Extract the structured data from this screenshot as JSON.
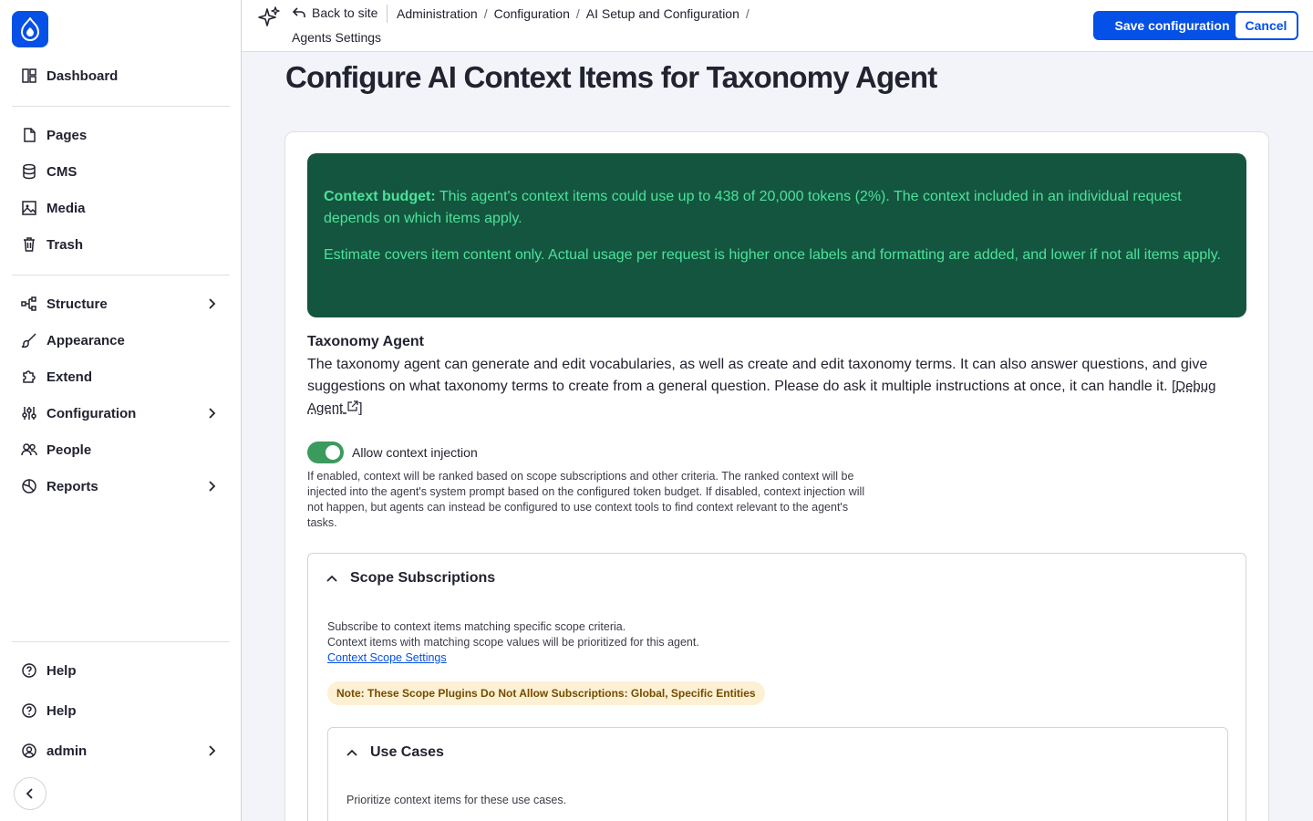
{
  "sidebar": {
    "items": [
      {
        "label": "Dashboard",
        "icon": "dashboard-icon"
      },
      {
        "label": "Pages",
        "icon": "page-icon"
      },
      {
        "label": "CMS",
        "icon": "database-icon"
      },
      {
        "label": "Media",
        "icon": "image-icon"
      },
      {
        "label": "Trash",
        "icon": "trash-icon"
      },
      {
        "label": "Structure",
        "icon": "structure-icon"
      },
      {
        "label": "Appearance",
        "icon": "brush-icon"
      },
      {
        "label": "Extend",
        "icon": "puzzle-icon"
      },
      {
        "label": "Configuration",
        "icon": "sliders-icon"
      },
      {
        "label": "People",
        "icon": "people-icon"
      },
      {
        "label": "Reports",
        "icon": "chart-pie-icon"
      }
    ],
    "bottom": [
      {
        "label": "Help",
        "icon": "help-icon"
      },
      {
        "label": "Help",
        "icon": "help-icon"
      },
      {
        "label": "admin",
        "icon": "user-icon"
      }
    ]
  },
  "topbar": {
    "back_label": "Back to site",
    "breadcrumbs": [
      "Administration",
      "Configuration",
      "AI Setup and Configuration"
    ],
    "breadcrumb_last": "Agents Settings",
    "save_label": "Save configuration",
    "cancel_label": "Cancel"
  },
  "page": {
    "title": "Configure AI Context Items for Taxonomy Agent",
    "budget_strong": "Context budget:",
    "budget_text": " This agent's context items could use up to 438 of 20,000 tokens (2%). The context included in an individual request depends on which items apply.",
    "budget_note": "Estimate covers item content only. Actual usage per request is higher once labels and formatting are added, and lower if not all items apply.",
    "agent_name": "Taxonomy Agent",
    "agent_desc": "The taxonomy agent can generate and edit vocabularies, as well as create and edit taxonomy terms. It can also answer questions, and give suggestions on what taxonomy terms to create from a general question. Please do ask it multiple instructions at once, it can handle it. ",
    "debug_link": "Debug Agent",
    "toggle_label": "Allow context injection",
    "toggle_on": true,
    "toggle_help": "If enabled, context will be ranked based on scope subscriptions and other criteria. The ranked context will be injected into the agent's system prompt based on the configured token budget. If disabled, context injection will not happen, but agents can instead be configured to use context tools to find context relevant to the agent's tasks.",
    "scope_title": "Scope Subscriptions",
    "scope_desc_1": "Subscribe to context items matching specific scope criteria.",
    "scope_desc_2": "Context items with matching scope values will be prioritized for this agent.",
    "scope_link": "Context Scope Settings",
    "note": "Note: These Scope Plugins Do Not Allow Subscriptions: Global, Specific Entities",
    "use_cases_title": "Use Cases",
    "use_cases_desc": "Prioritize context items for these use cases."
  },
  "colors": {
    "accent": "#0550e6",
    "budget_bg": "#14553f",
    "budget_text": "#4be29b",
    "toggle_on": "#3a9b5d",
    "note_bg": "#fdf0d3"
  }
}
